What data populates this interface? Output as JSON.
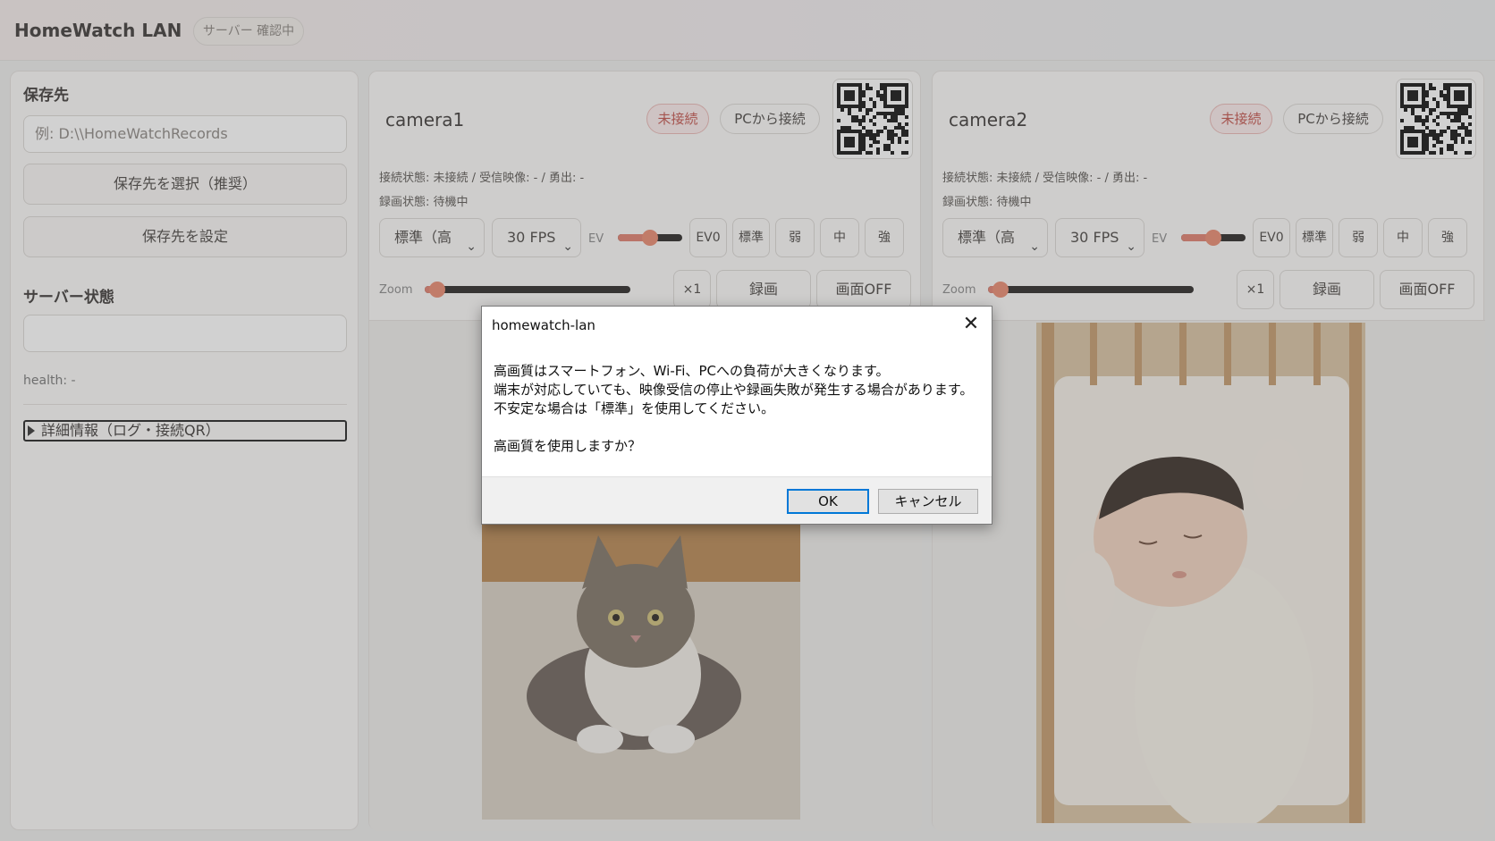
{
  "header": {
    "app_title": "HomeWatch LAN",
    "server_badge": "サーバー 確認中"
  },
  "sidebar": {
    "save_title": "保存先",
    "path_placeholder": "例: D:\\\\HomeWatchRecords",
    "select_button": "保存先を選択（推奨）",
    "set_button": "保存先を設定",
    "server_title": "サーバー状態",
    "server_value": "",
    "health": "health: -",
    "details": "詳細情報（ログ・接続QR）"
  },
  "cameras": [
    {
      "name": "camera1",
      "status_badge": "未接続",
      "connect_button": "PCから接続",
      "conn_status": "接続状態: 未接続 / 受信映像: - / 勇出: -",
      "rec_status": "録画状態: 待機中",
      "quality": "標準（高",
      "fps": "30 FPS",
      "ev_label": "EV",
      "ev_value": "EV0",
      "ev_level": 0.5,
      "presets": [
        "標準",
        "弱",
        "中",
        "強"
      ],
      "zoom_label": "Zoom",
      "zoom_level": 0.06,
      "zoom_value": "×1",
      "record_button": "録画",
      "screen_off_button": "画面OFF"
    },
    {
      "name": "camera2",
      "status_badge": "未接続",
      "connect_button": "PCから接続",
      "conn_status": "接続状態: 未接続 / 受信映像: - / 勇出: -",
      "rec_status": "録画状態: 待機中",
      "quality": "標準（高",
      "fps": "30 FPS",
      "ev_label": "EV",
      "ev_value": "EV0",
      "ev_level": 0.5,
      "presets": [
        "標準",
        "弱",
        "中",
        "強"
      ],
      "zoom_label": "Zoom",
      "zoom_level": 0.06,
      "zoom_value": "×1",
      "record_button": "録画",
      "screen_off_button": "画面OFF"
    }
  ],
  "dialog": {
    "title": "homewatch-lan",
    "lines": [
      "高画質はスマートフォン、Wi-Fi、PCへの負荷が大きくなります。",
      "端末が対応していても、映像受信の停止や録画失敗が発生する場合があります。",
      "不安定な場合は「標準」を使用してください。",
      "",
      "高画質を使用しますか？"
    ],
    "ok": "OK",
    "cancel": "キャンセル"
  },
  "icons": {
    "close": "close-icon",
    "qr": "qr-code-icon",
    "chevron": "chevron-down-icon"
  },
  "colors": {
    "accent": "#e07f6e",
    "badge_red": "#c2524b",
    "dialog_focus": "#0078d7"
  }
}
